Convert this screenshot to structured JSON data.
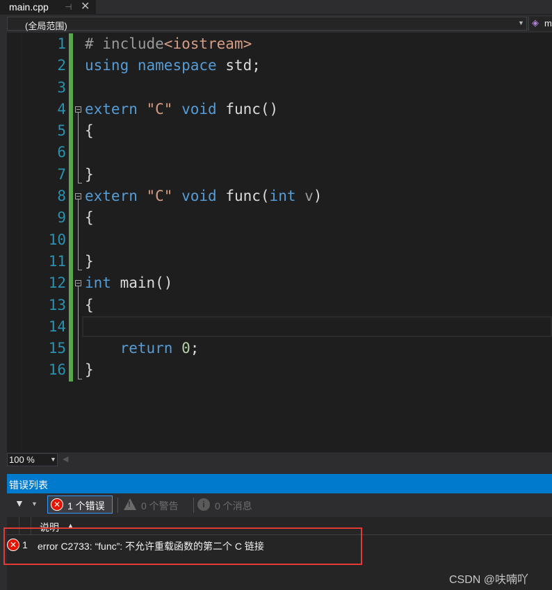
{
  "tab": {
    "title": "main.cpp",
    "pin_icon": "pin-icon",
    "close_icon": "close-icon"
  },
  "navbar": {
    "scope": "(全局范围)",
    "member": "m"
  },
  "editor": {
    "line_numbers": [
      "1",
      "2",
      "3",
      "4",
      "5",
      "6",
      "7",
      "8",
      "9",
      "10",
      "11",
      "12",
      "13",
      "14",
      "15",
      "16"
    ],
    "lines": [
      [
        {
          "t": "# include",
          "c": "pre"
        },
        {
          "t": "<iostream>",
          "c": "inc"
        }
      ],
      [
        {
          "t": "using",
          "c": "kw"
        },
        {
          "t": " ",
          "c": ""
        },
        {
          "t": "namespace",
          "c": "kw"
        },
        {
          "t": " std;",
          "c": ""
        }
      ],
      [],
      [
        {
          "t": "extern",
          "c": "kw"
        },
        {
          "t": " ",
          "c": ""
        },
        {
          "t": "\"C\"",
          "c": "str"
        },
        {
          "t": " ",
          "c": ""
        },
        {
          "t": "void",
          "c": "kw"
        },
        {
          "t": " func()",
          "c": ""
        }
      ],
      [
        {
          "t": "{",
          "c": ""
        }
      ],
      [],
      [
        {
          "t": "}",
          "c": ""
        }
      ],
      [
        {
          "t": "extern",
          "c": "kw"
        },
        {
          "t": " ",
          "c": ""
        },
        {
          "t": "\"C\"",
          "c": "str"
        },
        {
          "t": " ",
          "c": ""
        },
        {
          "t": "void",
          "c": "kw"
        },
        {
          "t": " func(",
          "c": ""
        },
        {
          "t": "int",
          "c": "kw"
        },
        {
          "t": " ",
          "c": ""
        },
        {
          "t": "v",
          "c": "par"
        },
        {
          "t": ")",
          "c": ""
        }
      ],
      [
        {
          "t": "{",
          "c": ""
        }
      ],
      [],
      [
        {
          "t": "}",
          "c": ""
        }
      ],
      [
        {
          "t": "int",
          "c": "kw"
        },
        {
          "t": " main()",
          "c": ""
        }
      ],
      [
        {
          "t": "{",
          "c": ""
        }
      ],
      [],
      [
        {
          "t": "    ",
          "c": ""
        },
        {
          "t": "return",
          "c": "kw"
        },
        {
          "t": " ",
          "c": ""
        },
        {
          "t": "0",
          "c": "num"
        },
        {
          "t": ";",
          "c": ""
        }
      ],
      [
        {
          "t": "}",
          "c": ""
        }
      ]
    ]
  },
  "zoom": {
    "value": "100 %"
  },
  "error_list": {
    "title": "错误列表",
    "errors_label": "1 个错误",
    "warnings_label": "0 个警告",
    "messages_label": "0 个消息",
    "column_description": "说明",
    "rows": [
      {
        "num": "1",
        "description": "error C2733: “func”: 不允许重载函数的第二个 C 链接"
      }
    ]
  },
  "watermark": "CSDN @呋喃吖",
  "colors": {
    "accent": "#007acc",
    "error": "#e51400",
    "highlight_box": "#e53935",
    "change_bar": "#57a64a"
  }
}
